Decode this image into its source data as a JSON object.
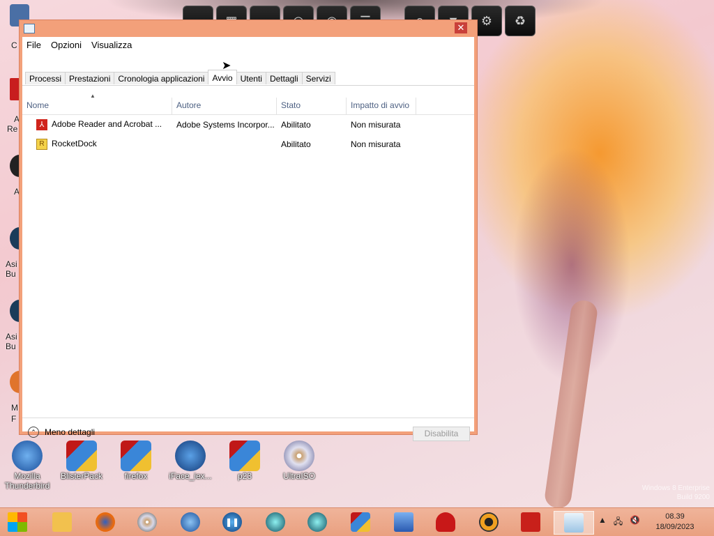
{
  "window": {
    "menu": [
      "File",
      "Opzioni",
      "Visualizza"
    ],
    "tabs": [
      "Processi",
      "Prestazioni",
      "Cronologia applicazioni",
      "Avvio",
      "Utenti",
      "Dettagli",
      "Servizi"
    ],
    "active_tab": "Avvio",
    "columns": [
      "Nome",
      "Autore",
      "Stato",
      "Impatto di avvio"
    ],
    "rows": [
      {
        "name": "Adobe Reader and Acrobat ...",
        "author": "Adobe Systems Incorpor...",
        "status": "Abilitato",
        "impact": "Non misurata",
        "icon": "adobe-icon"
      },
      {
        "name": "RocketDock",
        "author": "",
        "status": "Abilitato",
        "impact": "Non misurata",
        "icon": "rocketdock-icon"
      }
    ],
    "less_details_label": "Meno dettagli",
    "disable_label": "Disabilita",
    "close_glyph": "✕"
  },
  "desktop_icons": [
    "Mozilla Thunderbird",
    "BlisterPack",
    "firefox",
    "iFace_iex...",
    "p23",
    "UltraISO"
  ],
  "left_labels": [
    "C",
    "A",
    "Re",
    "A",
    "Asi",
    "Bu",
    "Asi",
    "Bu",
    "M",
    "F"
  ],
  "taskbar": {
    "clock_time": "08.39",
    "clock_date": "18/09/2023",
    "apps": [
      "windows-logo",
      "file-explorer",
      "firefox",
      "dvd",
      "thunderbird",
      "pause-app",
      "globe-app",
      "globe-app-2",
      "blisterpack",
      "windows-app",
      "redhat",
      "vlc-app",
      "adobe-reader",
      "task-manager"
    ]
  },
  "watermark": [
    "Windows 8 Enterprise",
    "Build 9200"
  ],
  "colors": {
    "window_frame": "#f3a07a",
    "taskbar": "#e9a080",
    "header_text": "#4d6082"
  }
}
